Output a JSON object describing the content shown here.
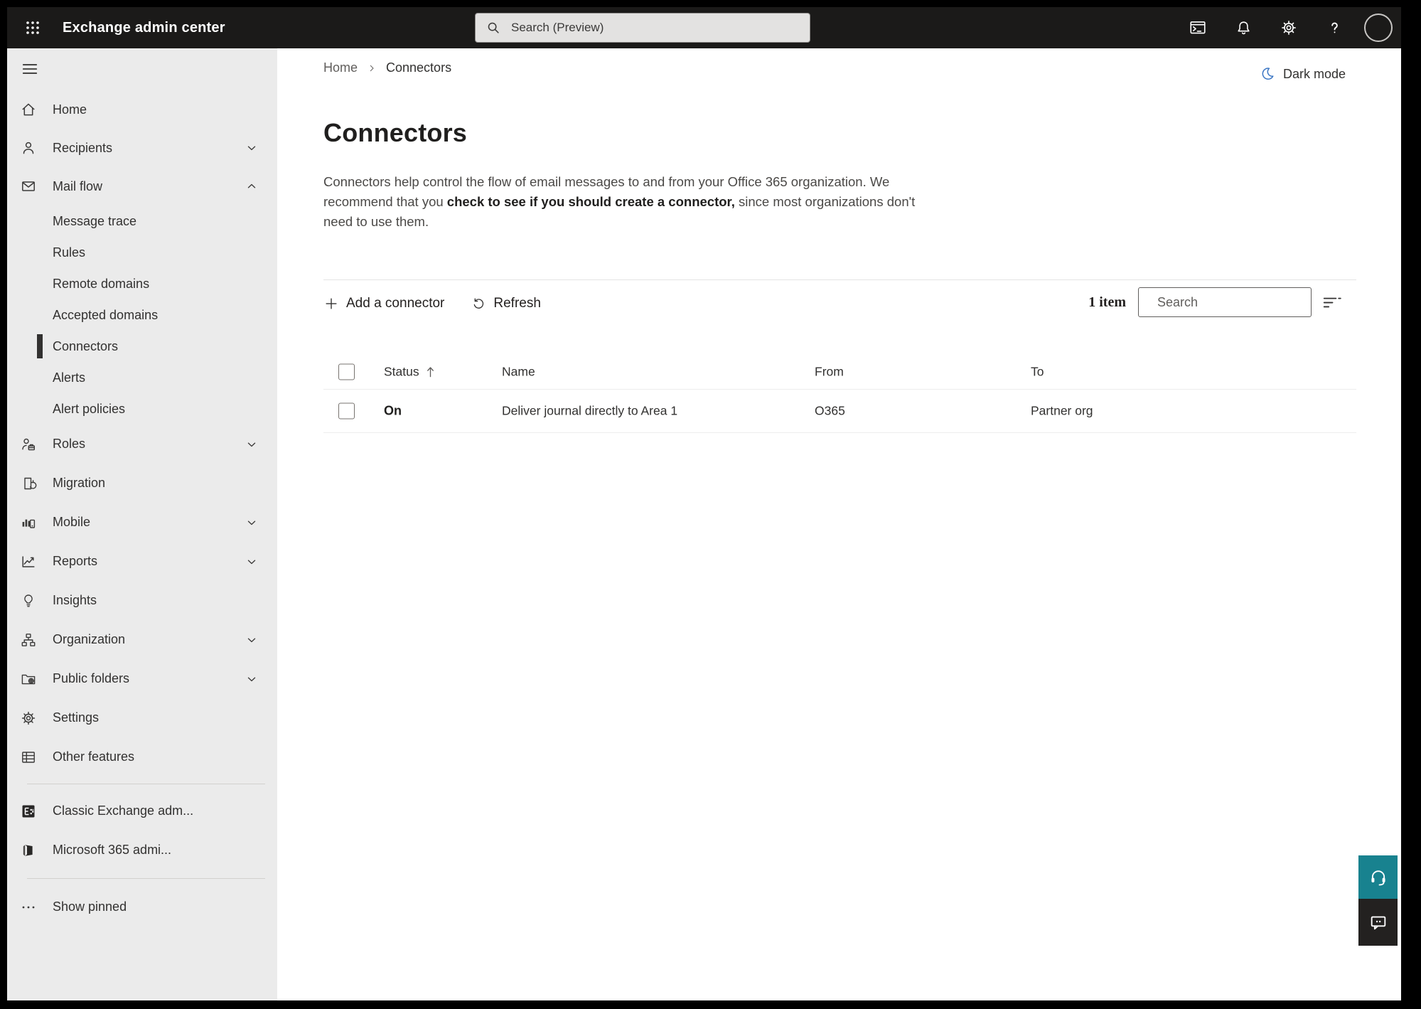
{
  "colors": {
    "topbar_bg": "#1b1a19",
    "sidebar_bg": "#ebebeb",
    "selection_indicator": "#323130",
    "dark_mode_icon_blue": "#3b76c4",
    "help_button_teal": "#18828f",
    "feedback_button_dark": "#232120"
  },
  "topbar": {
    "title": "Exchange admin center",
    "search_placeholder": "Search (Preview)"
  },
  "sidebar": {
    "items": [
      {
        "label": "Home"
      },
      {
        "label": "Recipients"
      },
      {
        "label": "Mail flow"
      },
      {
        "label": "Message trace"
      },
      {
        "label": "Rules"
      },
      {
        "label": "Remote domains"
      },
      {
        "label": "Accepted domains"
      },
      {
        "label": "Connectors"
      },
      {
        "label": "Alerts"
      },
      {
        "label": "Alert policies"
      },
      {
        "label": "Roles"
      },
      {
        "label": "Migration"
      },
      {
        "label": "Mobile"
      },
      {
        "label": "Reports"
      },
      {
        "label": "Insights"
      },
      {
        "label": "Organization"
      },
      {
        "label": "Public folders"
      },
      {
        "label": "Settings"
      },
      {
        "label": "Other features"
      },
      {
        "label": "Classic Exchange adm..."
      },
      {
        "label": "Microsoft 365 admi..."
      },
      {
        "label": "Show pinned"
      }
    ]
  },
  "breadcrumb": {
    "items": [
      "Home",
      "Connectors"
    ],
    "separator": "›"
  },
  "header_actions": {
    "dark_mode": "Dark mode"
  },
  "page": {
    "title": "Connectors",
    "description": {
      "pre": "Connectors help control the flow of email messages to and from your Office 365 organization. We recommend that you ",
      "link": "check to see if you should create a connector,",
      "post": " since most organizations don't need to use them."
    }
  },
  "toolbar": {
    "add_connector": "Add a connector",
    "refresh": "Refresh",
    "item_count": "1 item",
    "search_placeholder": "Search"
  },
  "table": {
    "headers": {
      "status": "Status",
      "name": "Name",
      "from": "From",
      "to": "To"
    },
    "rows": [
      {
        "status": "On",
        "name": "Deliver journal directly to Area 1",
        "from": "O365",
        "to": "Partner org"
      }
    ]
  }
}
